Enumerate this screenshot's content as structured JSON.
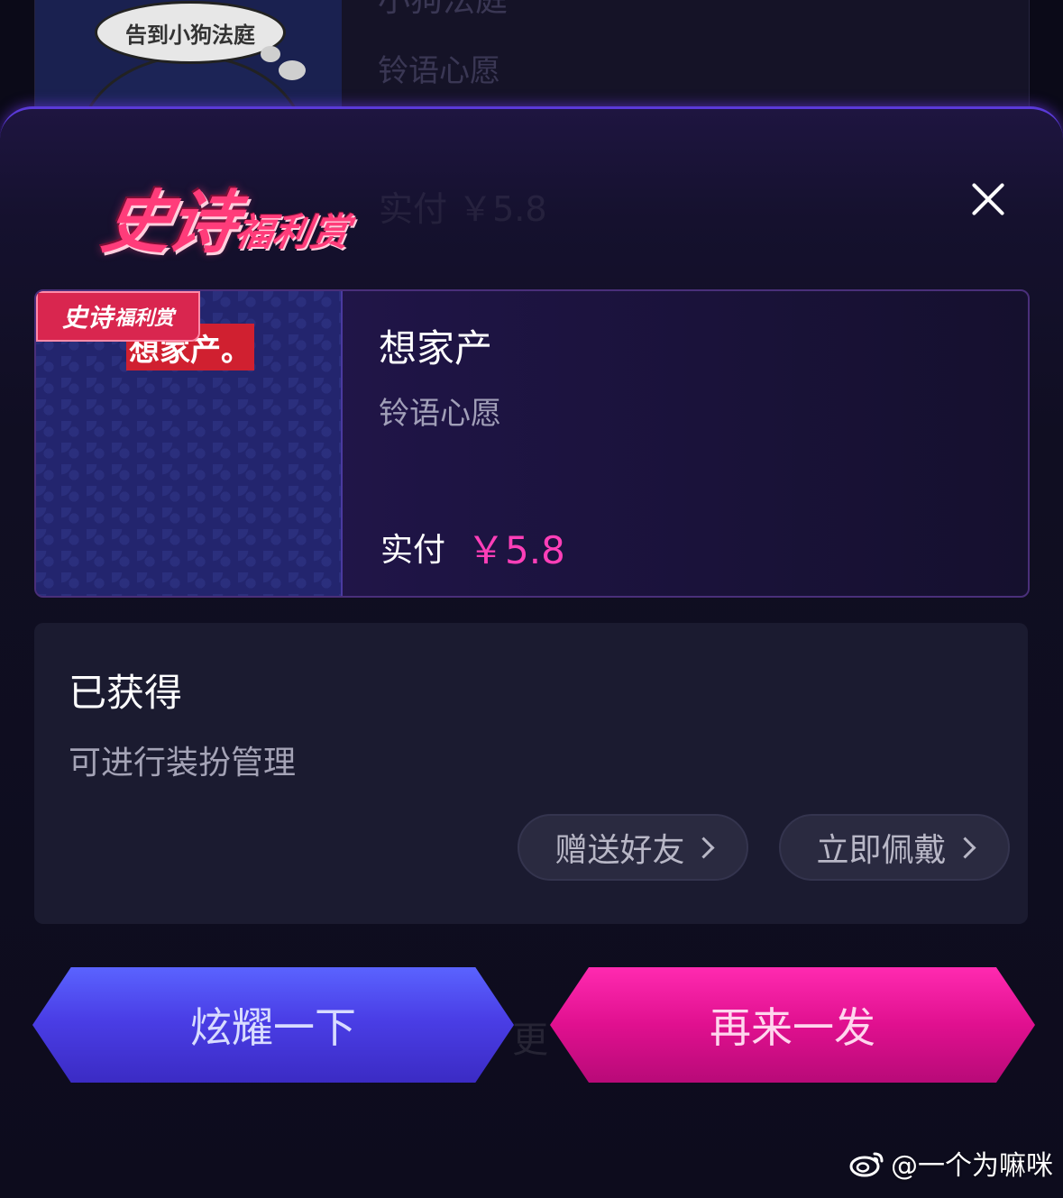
{
  "background_card": {
    "bubble_text": "告到小狗法庭",
    "title": "小狗法庭",
    "subtitle": "铃语心愿"
  },
  "sheet": {
    "logo_main": "史诗",
    "logo_sub": "福利赏",
    "ghost_text": "实付 ￥5.8"
  },
  "item": {
    "badge_main": "史诗",
    "badge_sub": "福利赏",
    "thumb_label": "想家产。",
    "name": "想家产",
    "category": "铃语心愿",
    "pay_label": "实付",
    "price": "￥5.8"
  },
  "obtained": {
    "title": "已获得",
    "subtitle": "可进行装扮管理",
    "gift_label": "赠送好友",
    "wear_label": "立即佩戴"
  },
  "buttons": {
    "show_off": "炫耀一下",
    "again": "再来一发",
    "ghost": "更"
  },
  "watermark": {
    "text": "@一个为嘛咪"
  },
  "colors": {
    "accent_pink": "#ff3fb8",
    "logo_red": "#ff3c7a",
    "button_blue": "#4a3ee6",
    "button_magenta": "#e0108f"
  }
}
